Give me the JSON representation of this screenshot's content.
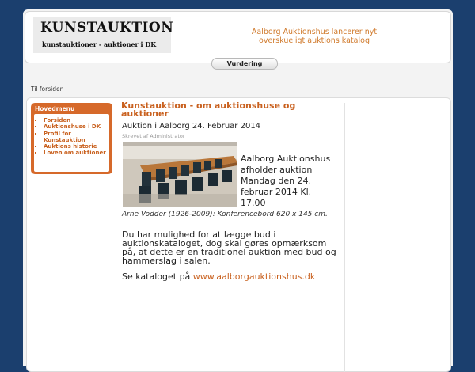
{
  "header": {
    "logo_title": "KUNSTAUKTION",
    "logo_subtitle": "kunstauktioner - auktioner i DK",
    "tagline": "Aalborg Auktionshus lancerer nyt overskueligt auktions katalog"
  },
  "nav": {
    "tab_label": "Vurdering"
  },
  "breadcrumb": {
    "home_link": "Til forsiden"
  },
  "sidebar": {
    "title": "Hovedmenu",
    "items": [
      {
        "label": "Forsiden"
      },
      {
        "label": "Auktionshuse i DK"
      },
      {
        "label": "Profil for Kunstauktion"
      },
      {
        "label": "Auktions historie"
      },
      {
        "label": "Loven om auktioner"
      }
    ]
  },
  "article": {
    "title": "Kunstauktion - om auktionshuse og auktioner",
    "subtitle": "Auktion i Aalborg 24. Februar 2014",
    "byline": "Skrevet af Administrator",
    "intro": "Aalborg Auktionshus afholder auktion Mandag den 24. februar 2014 Kl. 17.00",
    "caption": "Arne Vodder (1926-2009): Konferencebord 620 x 145 cm.",
    "body": "Du har mulighed for at lægge bud i auktionskataloget, dog skal gøres opmærksom på, at dette er en traditionel auktion med bud og hammerslag i salen.",
    "catalog_prefix": "Se kataloget på",
    "catalog_link": "www.aalborgauktionshus.dk"
  },
  "colors": {
    "background": "#1b3f6e",
    "accent": "#c9611f",
    "menu_box": "#d6692a",
    "tagline": "#d07a2c"
  }
}
